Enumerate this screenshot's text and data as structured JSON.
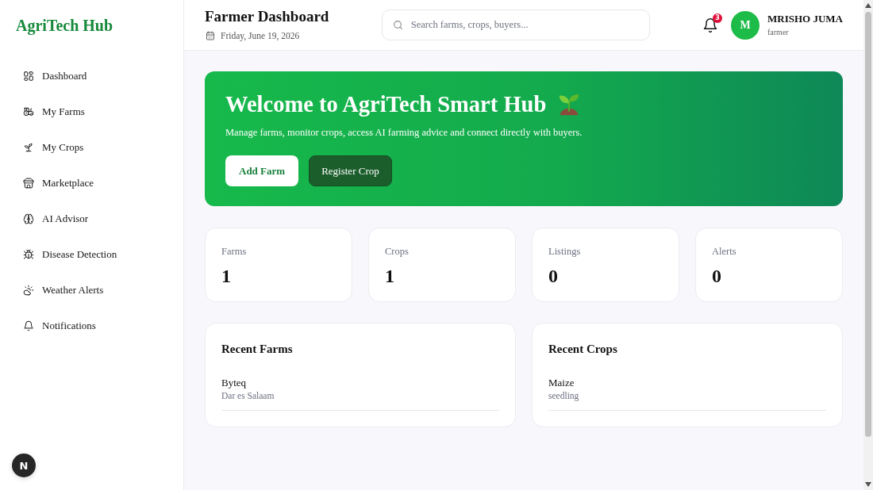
{
  "sidebar": {
    "logo": "AgriTech Hub",
    "items": [
      {
        "label": "Dashboard",
        "selected": false
      },
      {
        "label": "My Farms",
        "selected": false
      },
      {
        "label": "My Crops",
        "selected": false
      },
      {
        "label": "Marketplace",
        "selected": false
      },
      {
        "label": "AI Advisor",
        "selected": false
      },
      {
        "label": "Disease Detection",
        "selected": false
      },
      {
        "label": "Weather Alerts",
        "selected": false
      },
      {
        "label": "Notifications",
        "selected": false
      }
    ]
  },
  "dev_badge": {
    "label": "N"
  },
  "topbar": {
    "title": "Farmer Dashboard",
    "date": "Friday, June 19, 2026",
    "search": {
      "placeholder": "Search farms, crops, buyers..."
    },
    "notifications": {
      "count": "3"
    },
    "user": {
      "initial": "M",
      "name": "MRISHO JUMA",
      "role": "farmer"
    }
  },
  "hero": {
    "title": "Welcome to AgriTech Smart Hub",
    "subtitle": "Manage farms, monitor crops, access AI farming advice and connect directly with buyers.",
    "buttons": [
      {
        "label": "Add Farm",
        "kind": "primary"
      },
      {
        "label": "Register Crop",
        "kind": "secondary"
      }
    ]
  },
  "stats": [
    {
      "label": "Farms",
      "value": "1"
    },
    {
      "label": "Crops",
      "value": "1"
    },
    {
      "label": "Listings",
      "value": "0"
    },
    {
      "label": "Alerts",
      "value": "0"
    }
  ],
  "recent": [
    {
      "title": "Recent Farms",
      "items": [
        {
          "name": "Byteq",
          "detail": "Dar es Salaam"
        }
      ]
    },
    {
      "title": "Recent Crops",
      "items": [
        {
          "name": "Maize",
          "detail": "seedling"
        }
      ]
    }
  ]
}
